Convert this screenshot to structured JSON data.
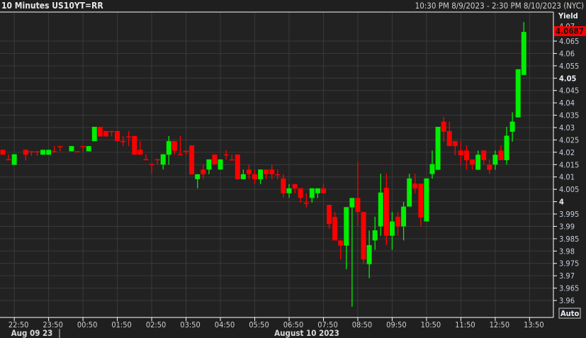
{
  "header": {
    "title": "10 Minutes US10YT=RR",
    "range": "10:30 PM 8/9/2023 - 2:30 PM 8/10/2023 (NYC)"
  },
  "axis": {
    "y_title": "Yield",
    "auto_label": "Auto",
    "last_price_label": "4.0687",
    "top_hidden_label": "4.07"
  },
  "colors": {
    "up": "#00ee00",
    "down": "#ff0000",
    "bg": "#222222",
    "grid": "#3a3a3a",
    "price_tag": "#ff0000"
  },
  "chart_data": {
    "type": "candlestick",
    "title": "10 Minutes US10YT=RR",
    "ylabel": "Yield",
    "ylim": [
      3.955,
      4.075
    ],
    "y_ticks": [
      "4.065",
      "4.06",
      "4.055",
      "4.05",
      "4.045",
      "4.04",
      "4.035",
      "4.03",
      "4.025",
      "4.02",
      "4.015",
      "4.01",
      "4.005",
      "4",
      "3.995",
      "3.99",
      "3.985",
      "3.98",
      "3.975",
      "3.97",
      "3.965",
      "3.96"
    ],
    "y_bold_ticks": [
      "4.05",
      "4"
    ],
    "x_ticks": [
      "22:50",
      "23:50",
      "00:50",
      "01:50",
      "02:50",
      "03:50",
      "04:50",
      "05:50",
      "06:50",
      "07:50",
      "08:50",
      "09:50",
      "10:50",
      "11:50",
      "12:50",
      "13:50"
    ],
    "date_labels": [
      "Aug 09 23",
      "August 10 2023"
    ],
    "last_value": 4.0687,
    "candles": [
      [
        0,
        4.021,
        4.021,
        4.019,
        4.019
      ],
      [
        1,
        4.0172,
        4.0192,
        4.0172,
        4.0172
      ],
      [
        2,
        4.0149,
        4.0192,
        4.0149,
        4.0192
      ],
      [
        4,
        4.021,
        4.021,
        4.0167,
        4.019
      ],
      [
        5,
        4.0204,
        4.0204,
        4.0186,
        4.0204
      ],
      [
        6,
        4.0204,
        4.0204,
        4.0186,
        4.0204
      ],
      [
        7,
        4.019,
        4.021,
        4.019,
        4.021
      ],
      [
        8,
        4.019,
        4.021,
        4.019,
        4.021
      ],
      [
        9,
        4.0204,
        4.0225,
        4.0204,
        4.0204
      ],
      [
        10,
        4.0225,
        4.0225,
        4.0204,
        4.0225
      ],
      [
        12,
        4.0204,
        4.0225,
        4.0204,
        4.0225
      ],
      [
        13,
        4.0204,
        4.0204,
        4.0204,
        4.0204
      ],
      [
        14,
        4.0225,
        4.0225,
        4.0204,
        4.0225
      ],
      [
        15,
        4.0204,
        4.0225,
        4.0204,
        4.0225
      ],
      [
        16,
        4.0245,
        4.0303,
        4.0245,
        4.0303
      ],
      [
        17,
        4.0303,
        4.0303,
        4.0264,
        4.0264
      ],
      [
        18,
        4.0286,
        4.0286,
        4.0264,
        4.0264
      ],
      [
        19,
        4.0286,
        4.0286,
        4.0264,
        4.0286
      ],
      [
        20,
        4.0286,
        4.0286,
        4.0245,
        4.0245
      ],
      [
        21,
        4.0245,
        4.0266,
        4.0225,
        4.0245
      ],
      [
        22,
        4.0264,
        4.0286,
        4.0225,
        4.0264
      ],
      [
        23,
        4.0266,
        4.0266,
        4.019,
        4.019
      ],
      [
        24,
        4.021,
        4.0245,
        4.019,
        4.019
      ],
      [
        25,
        4.0172,
        4.0192,
        4.0172,
        4.0172
      ],
      [
        26,
        4.0153,
        4.0153,
        4.0112,
        4.0153
      ],
      [
        27,
        4.0172,
        4.0172,
        4.015,
        4.0172
      ],
      [
        28,
        4.015,
        4.0192,
        4.013,
        4.0192
      ],
      [
        29,
        4.019,
        4.0266,
        4.015,
        4.0245
      ],
      [
        30,
        4.0245,
        4.0245,
        4.019,
        4.0206
      ],
      [
        31,
        4.0192,
        4.0266,
        4.0192,
        4.0192
      ],
      [
        32,
        4.0206,
        4.0206,
        4.019,
        4.0206
      ],
      [
        33,
        4.0228,
        4.0228,
        4.011,
        4.011
      ],
      [
        34,
        4.0091,
        4.0111,
        4.0054,
        4.0111
      ],
      [
        35,
        4.013,
        4.015,
        4.0091,
        4.0111
      ],
      [
        36,
        4.013,
        4.0171,
        4.0111,
        4.0171
      ],
      [
        37,
        4.0191,
        4.0191,
        4.0151,
        4.0151
      ],
      [
        38,
        4.013,
        4.0171,
        4.013,
        4.0171
      ],
      [
        39,
        4.0191,
        4.0209,
        4.0171,
        4.0191
      ],
      [
        40,
        4.0171,
        4.0191,
        4.0171,
        4.0171
      ],
      [
        41,
        4.0191,
        4.0191,
        4.0091,
        4.0091
      ],
      [
        42,
        4.0091,
        4.013,
        4.0091,
        4.0111
      ],
      [
        43,
        4.013,
        4.015,
        4.0091,
        4.0111
      ],
      [
        44,
        4.0111,
        4.013,
        4.0071,
        4.0091
      ],
      [
        45,
        4.0091,
        4.013,
        4.0071,
        4.013
      ],
      [
        46,
        4.013,
        4.013,
        4.0091,
        4.0111
      ],
      [
        47,
        4.013,
        4.015,
        4.0091,
        4.0111
      ],
      [
        48,
        4.0111,
        4.013,
        4.0091,
        4.0111
      ],
      [
        49,
        4.0094,
        4.0111,
        4.0016,
        4.0034
      ],
      [
        50,
        4.0034,
        4.0071,
        4.0016,
        4.0054
      ],
      [
        51,
        4.0071,
        4.0071,
        4.0034,
        4.0054
      ],
      [
        52,
        4.0054,
        4.0054,
        3.9996,
        4.0015
      ],
      [
        53,
        3.9996,
        4.0034,
        3.9976,
        3.9996
      ],
      [
        54,
        4.0015,
        4.0054,
        3.9996,
        4.0054
      ],
      [
        55,
        4.0034,
        4.0054,
        4.0015,
        4.0054
      ],
      [
        56,
        4.0054,
        4.0071,
        4.0034,
        4.0034
      ],
      [
        57,
        3.9987,
        3.9987,
        3.9891,
        3.9909
      ],
      [
        58,
        3.9938,
        3.9958,
        3.9843,
        3.9843
      ],
      [
        59,
        3.9843,
        3.9843,
        3.9766,
        3.9822
      ],
      [
        60,
        3.9822,
        3.9978,
        3.9726,
        3.9978
      ],
      [
        61,
        3.9977,
        4.0015,
        3.9575,
        4.0015
      ],
      [
        62,
        4.0015,
        4.0162,
        3.9901,
        3.9958
      ],
      [
        63,
        3.9958,
        3.9958,
        3.9747,
        3.9766
      ],
      [
        64,
        3.9747,
        3.9883,
        3.969,
        3.9824
      ],
      [
        65,
        3.9843,
        3.9939,
        3.9805,
        3.9884
      ],
      [
        66,
        3.99,
        4.0113,
        3.9862,
        4.0037
      ],
      [
        67,
        4.0056,
        4.0113,
        3.9824,
        3.9862
      ],
      [
        68,
        3.9862,
        3.9958,
        3.9805,
        3.992
      ],
      [
        69,
        3.9939,
        3.9958,
        3.9862,
        3.99
      ],
      [
        70,
        3.99,
        3.9999,
        3.9843,
        3.998
      ],
      [
        71,
        3.998,
        4.0113,
        3.998,
        4.0094
      ],
      [
        72,
        4.0073,
        4.0113,
        4.0034,
        4.0054
      ],
      [
        73,
        4.0073,
        4.0073,
        3.9901,
        3.9936
      ],
      [
        74,
        3.992,
        4.0094,
        3.992,
        4.0094
      ],
      [
        75,
        4.0112,
        4.0207,
        4.0093,
        4.0152
      ],
      [
        76,
        4.0129,
        4.0303,
        4.0129,
        4.0303
      ],
      [
        77,
        4.0324,
        4.0343,
        4.0243,
        4.0283
      ],
      [
        78,
        4.0286,
        4.0324,
        4.0225,
        4.0225
      ],
      [
        79,
        4.0245,
        4.0245,
        4.0188,
        4.0225
      ],
      [
        80,
        4.0207,
        4.0245,
        4.015,
        4.0188
      ],
      [
        81,
        4.0207,
        4.0228,
        4.0129,
        4.0168
      ],
      [
        82,
        4.0171,
        4.0171,
        4.0129,
        4.015
      ],
      [
        83,
        4.0129,
        4.0207,
        4.0129,
        4.019
      ],
      [
        84,
        4.0207,
        4.0207,
        4.015,
        4.0168
      ],
      [
        85,
        4.015,
        4.0171,
        4.0112,
        4.0129
      ],
      [
        86,
        4.015,
        4.0207,
        4.0129,
        4.019
      ],
      [
        87,
        4.0207,
        4.0228,
        4.0168,
        4.0168
      ],
      [
        88,
        4.0168,
        4.0303,
        4.015,
        4.0267
      ],
      [
        89,
        4.0283,
        4.0362,
        4.0243,
        4.0324
      ],
      [
        90,
        4.0341,
        4.0536,
        4.0341,
        4.0536
      ],
      [
        91,
        4.0513,
        4.0727,
        4.0513,
        4.0687
      ]
    ]
  }
}
